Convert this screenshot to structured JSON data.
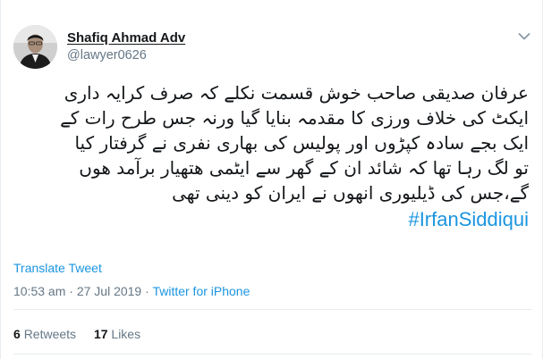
{
  "author": {
    "name": "Shafiq Ahmad Adv",
    "handle": "@lawyer0626",
    "avatar_icon": "profile-photo"
  },
  "menu_icon": "chevron-down-icon",
  "tweet": {
    "lines": [
      "عرفان صدیقی صاحب خوش قسمت نکلے کہ صرف کرایہ داری",
      "ایکٹ کی خلاف ورزی کا مقدمہ بنایا گیا ورنہ جس طرح رات کے",
      "ایک بجے سادہ کپڑوں اور پولیس کی بھاری نفری نے گرفتار کیا",
      "تو لگ رہا تھا کہ شائد ان کے گھر سے ایٹمی ھتھیار برآمد ھوں",
      "گے،جس کی ڈیلیوری انھوں نے ایران کو دینی تھی"
    ],
    "hashtag": "#IrfanSiddiqui"
  },
  "translate_label": "Translate Tweet",
  "meta": {
    "time": "10:53 am",
    "separator1": " · ",
    "date": "27 Jul 2019",
    "separator2": " · ",
    "source": "Twitter for iPhone"
  },
  "stats": {
    "retweets_count": "6",
    "retweets_label": "Retweets",
    "likes_count": "17",
    "likes_label": "Likes"
  },
  "colors": {
    "link": "#1b95e0",
    "secondary": "#657786",
    "text": "#14171a",
    "divider": "#e6ecf0"
  }
}
